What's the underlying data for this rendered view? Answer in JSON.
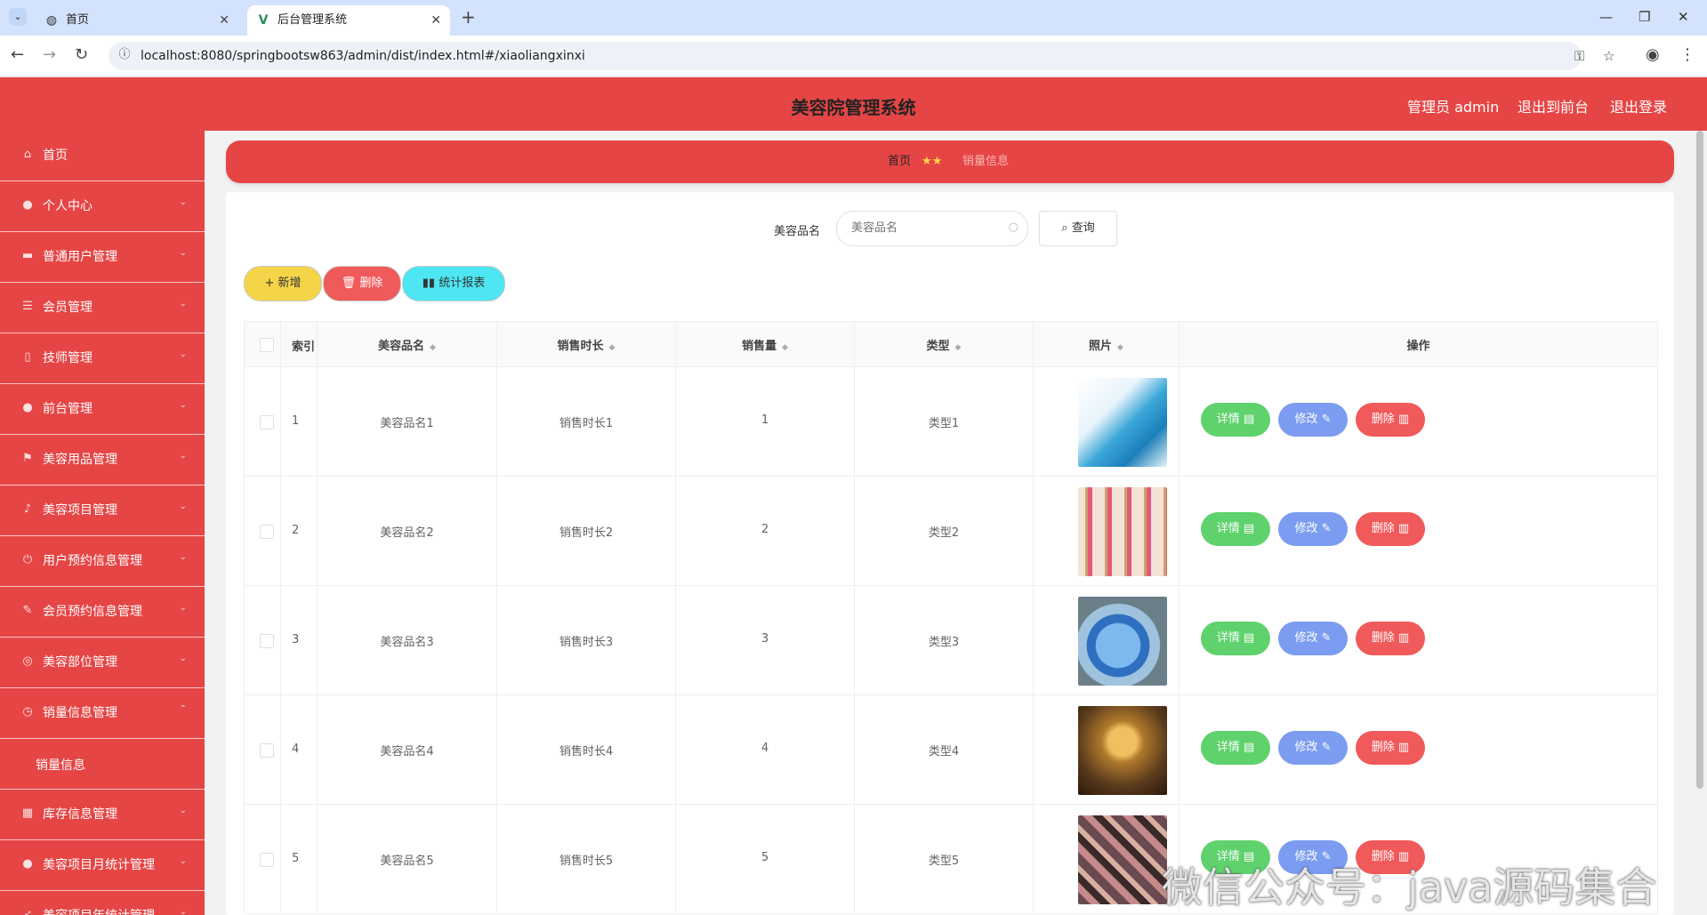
{
  "browser": {
    "tabs": [
      {
        "title": "首页",
        "icon": "globe-icon"
      },
      {
        "title": "后台管理系统",
        "icon": "vue-logo-icon"
      }
    ],
    "url": "localhost:8080/springbootsw863/admin/dist/index.html#/xiaoliangxinxi"
  },
  "header": {
    "title": "美容院管理系统",
    "admin": "管理员 admin",
    "to_front": "退出到前台",
    "logout": "退出登录",
    "accent_color": "#e64545"
  },
  "sidebar": {
    "items": [
      {
        "label": "首页",
        "icon": "home-icon"
      },
      {
        "label": "个人中心",
        "icon": "user-icon"
      },
      {
        "label": "普通用户管理",
        "icon": "monitor-icon"
      },
      {
        "label": "会员管理",
        "icon": "list-icon"
      },
      {
        "label": "技师管理",
        "icon": "phone-icon"
      },
      {
        "label": "前台管理",
        "icon": "user-icon"
      },
      {
        "label": "美容用品管理",
        "icon": "flag-icon"
      },
      {
        "label": "美容项目管理",
        "icon": "mic-icon"
      },
      {
        "label": "用户预约信息管理",
        "icon": "power-icon"
      },
      {
        "label": "会员预约信息管理",
        "icon": "edit-icon"
      },
      {
        "label": "美容部位管理",
        "icon": "compass-icon"
      },
      {
        "label": "销量信息管理",
        "icon": "clock-icon"
      },
      {
        "label": "销量信息",
        "sub": true
      },
      {
        "label": "库存信息管理",
        "icon": "grid-icon"
      },
      {
        "label": "美容项目月统计管理",
        "icon": "circle-icon"
      },
      {
        "label": "美容项目年统计管理",
        "icon": "rocket-icon"
      }
    ]
  },
  "breadcrumb": {
    "home": "首页",
    "current": "销量信息"
  },
  "search": {
    "label": "美容品名",
    "placeholder": "美容品名",
    "button": "查询"
  },
  "actions": {
    "add": "新增",
    "delete": "删除",
    "report": "统计报表"
  },
  "table": {
    "headers": {
      "index": "索引",
      "name": "美容品名",
      "duration": "销售时长",
      "volume": "销售量",
      "type": "类型",
      "photo": "照片",
      "ops": "操作"
    },
    "rows": [
      {
        "index": "1",
        "name": "美容品名1",
        "duration": "销售时长1",
        "volume": "1",
        "type": "类型1",
        "photo": "skincare-bottles-image"
      },
      {
        "index": "2",
        "name": "美容品名2",
        "duration": "销售时长2",
        "volume": "2",
        "type": "类型2",
        "photo": "lipsticks-image"
      },
      {
        "index": "3",
        "name": "美容品名3",
        "duration": "销售时长3",
        "volume": "3",
        "type": "类型3",
        "photo": "cream-jar-image"
      },
      {
        "index": "4",
        "name": "美容品名4",
        "duration": "销售时长4",
        "volume": "4",
        "type": "类型4",
        "photo": "perfume-ad-image"
      },
      {
        "index": "5",
        "name": "美容品名5",
        "duration": "销售时长5",
        "volume": "5",
        "type": "类型5",
        "photo": "makeup-palette-image"
      }
    ],
    "op_labels": {
      "detail": "详情",
      "edit": "修改",
      "remove": "删除"
    }
  },
  "watermark": "微信公众号：java源码集合"
}
